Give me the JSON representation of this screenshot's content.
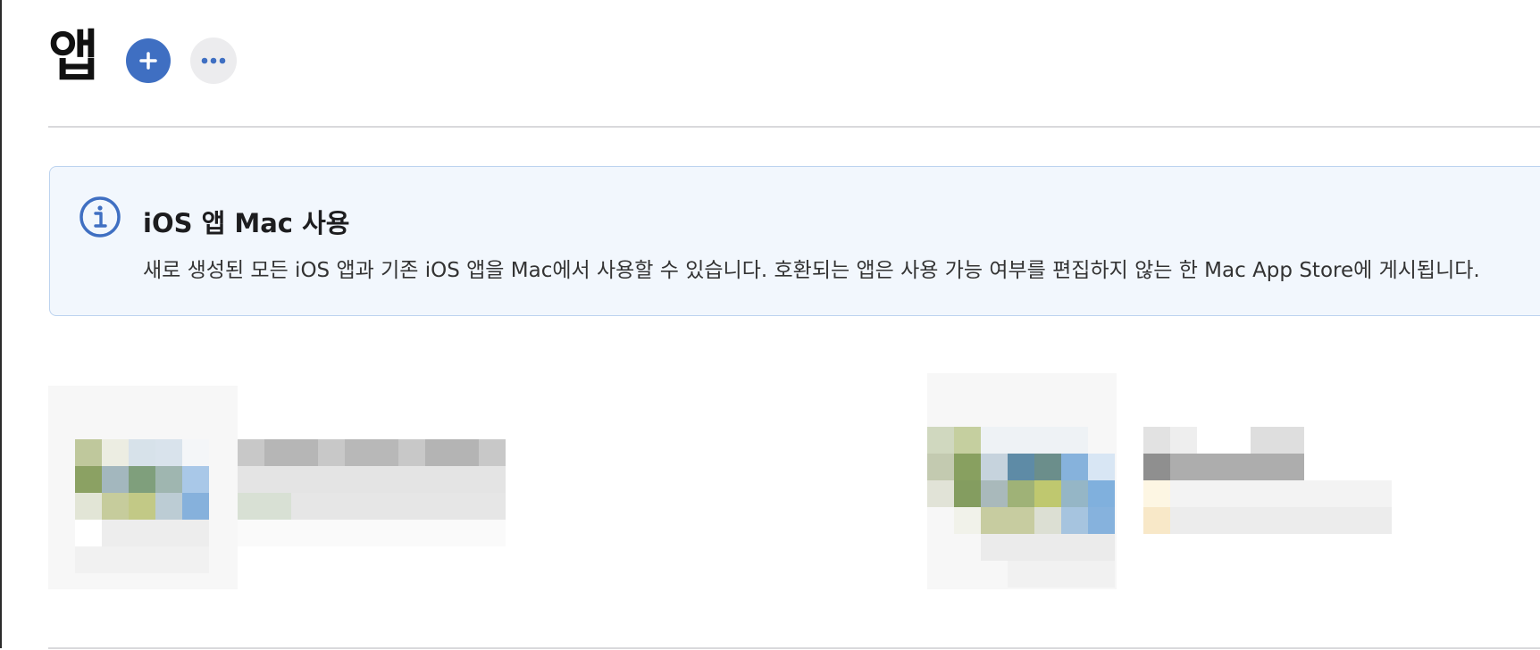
{
  "header": {
    "title": "앱",
    "add_icon": "plus-circle-icon",
    "more_icon": "ellipsis-icon",
    "accent": "#3f6fc2"
  },
  "banner": {
    "icon": "info-circle-icon",
    "title": "iOS 앱 Mac 사용",
    "text": "새로 생성된 모든 iOS 앱과 기존 iOS 앱을 Mac에서 사용할 수 있습니다. 호환되는 앱은 사용 가능 여부를 편집하지 않는 한 Mac App Store에 게시됩니다.",
    "background": "#f2f7fd",
    "border": "#bcd3ef"
  },
  "apps": [
    {
      "name": "",
      "details": "",
      "redacted": true
    },
    {
      "name": "",
      "details": "",
      "redacted": true
    }
  ]
}
